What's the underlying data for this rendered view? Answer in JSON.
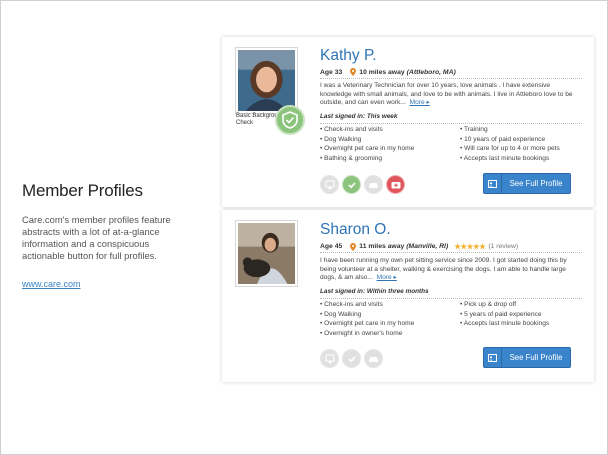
{
  "intro": {
    "title": "Member Profiles",
    "description": "Care.com's member profiles feature abstracts with a lot of at-a-glance information and a conspicuous actionable button for full profiles.",
    "link": "www.care.com"
  },
  "colors": {
    "accent": "#2f74b5",
    "button": "#3a84cb",
    "badge_green": "#8cc47e",
    "badge_red": "#e0555b",
    "star": "#f2b233"
  },
  "profiles": [
    {
      "name": "Kathy P.",
      "age": "Age 33",
      "distance": "10 miles away",
      "location": "(Attleboro, MA)",
      "bio": "I was a Veterinary Technician for over 10 years, love animals . I have extensive knowledge with small animals, and love to be with animals. I live in Attleboro love to be outside, and can even work...",
      "more": "More",
      "last_signed": "Last signed in: This week",
      "background_check": "Basic Background Check",
      "services_left": [
        "Check-ins and visits",
        "Dog Walking",
        "Overnight pet care in my home",
        "Bathing & grooming"
      ],
      "services_right": [
        "Training",
        "10 years of paid experience",
        "Will care for up to 4 or more pets",
        "Accepts last minute bookings"
      ],
      "badges": [
        "certificate-icon",
        "check-shield-icon",
        "car-icon",
        "first-aid-icon"
      ],
      "button": "See Full Profile"
    },
    {
      "name": "Sharon O.",
      "age": "Age 45",
      "distance": "11 miles away",
      "location": "(Manville, RI)",
      "stars": "★★★★★",
      "reviews": "(1 review)",
      "bio": "I have been running my own pet sitting service since 2009. I got started doing this by being volunteer at a shelter, walking & exercising the dogs. I am able to handle large dogs, & am also...",
      "more": "More",
      "last_signed": "Last signed in: Within three months",
      "services_left": [
        "Check-ins and visits",
        "Dog Walking",
        "Overnight pet care in my home",
        "Overnight in owner's home"
      ],
      "services_right": [
        "Pick up & drop off",
        "5 years of paid experience",
        "Accepts last minute bookings"
      ],
      "badges": [
        "certificate-icon",
        "check-shield-icon",
        "car-icon"
      ],
      "button": "See Full Profile"
    }
  ]
}
